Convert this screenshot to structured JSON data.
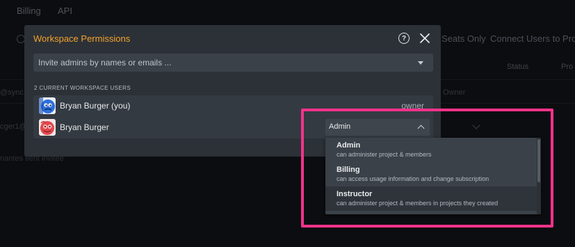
{
  "background": {
    "nav": [
      "Billing",
      "API"
    ],
    "toolbar": [
      "Seats Only",
      "Connect Users to Pro"
    ],
    "columns": [
      "Status",
      "Pro"
    ],
    "row_text": [
      "@sync",
      "Owner",
      "cger1@",
      "nantes tient invitee"
    ]
  },
  "modal": {
    "title": "Workspace Permissions",
    "help_icon": "?",
    "close_icon": "close-icon",
    "invite_placeholder": "Invite admins by names or emails ...",
    "section_label": "2 CURRENT WORKSPACE USERS",
    "users": [
      {
        "name": "Bryan Burger (you)",
        "role": "owner"
      },
      {
        "name": "Bryan Burger",
        "role": "Admin"
      }
    ]
  },
  "role_menu": {
    "items": [
      {
        "title": "Admin",
        "description": "can administer project & members"
      },
      {
        "title": "Billing",
        "description": "can access usage information and change subscription"
      },
      {
        "title": "Instructor",
        "description": "can administer project & members in projects they created"
      }
    ],
    "highlighted_index": 2
  },
  "colors": {
    "title_accent": "#f3a32c",
    "highlight_box": "#f2338a",
    "modal_bg": "#2c3137"
  }
}
